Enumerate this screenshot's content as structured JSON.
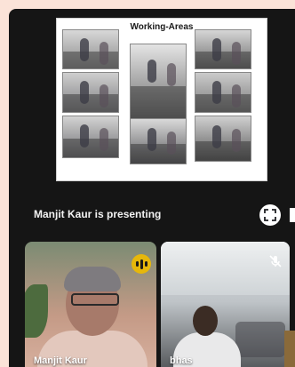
{
  "slide": {
    "title": "Working-Areas"
  },
  "presenting_text": "Manjit Kaur is presenting",
  "participants": [
    {
      "name": "Manjit Kaur",
      "status": "speaking"
    },
    {
      "name": "bhas",
      "status": "muted"
    }
  ],
  "icons": {
    "fullscreen": "fullscreen-icon",
    "speaking": "audio-level-icon",
    "mic_off": "mic-off-icon"
  },
  "colors": {
    "background": "#fbe3d8",
    "speaking_accent": "#e6b70b"
  }
}
